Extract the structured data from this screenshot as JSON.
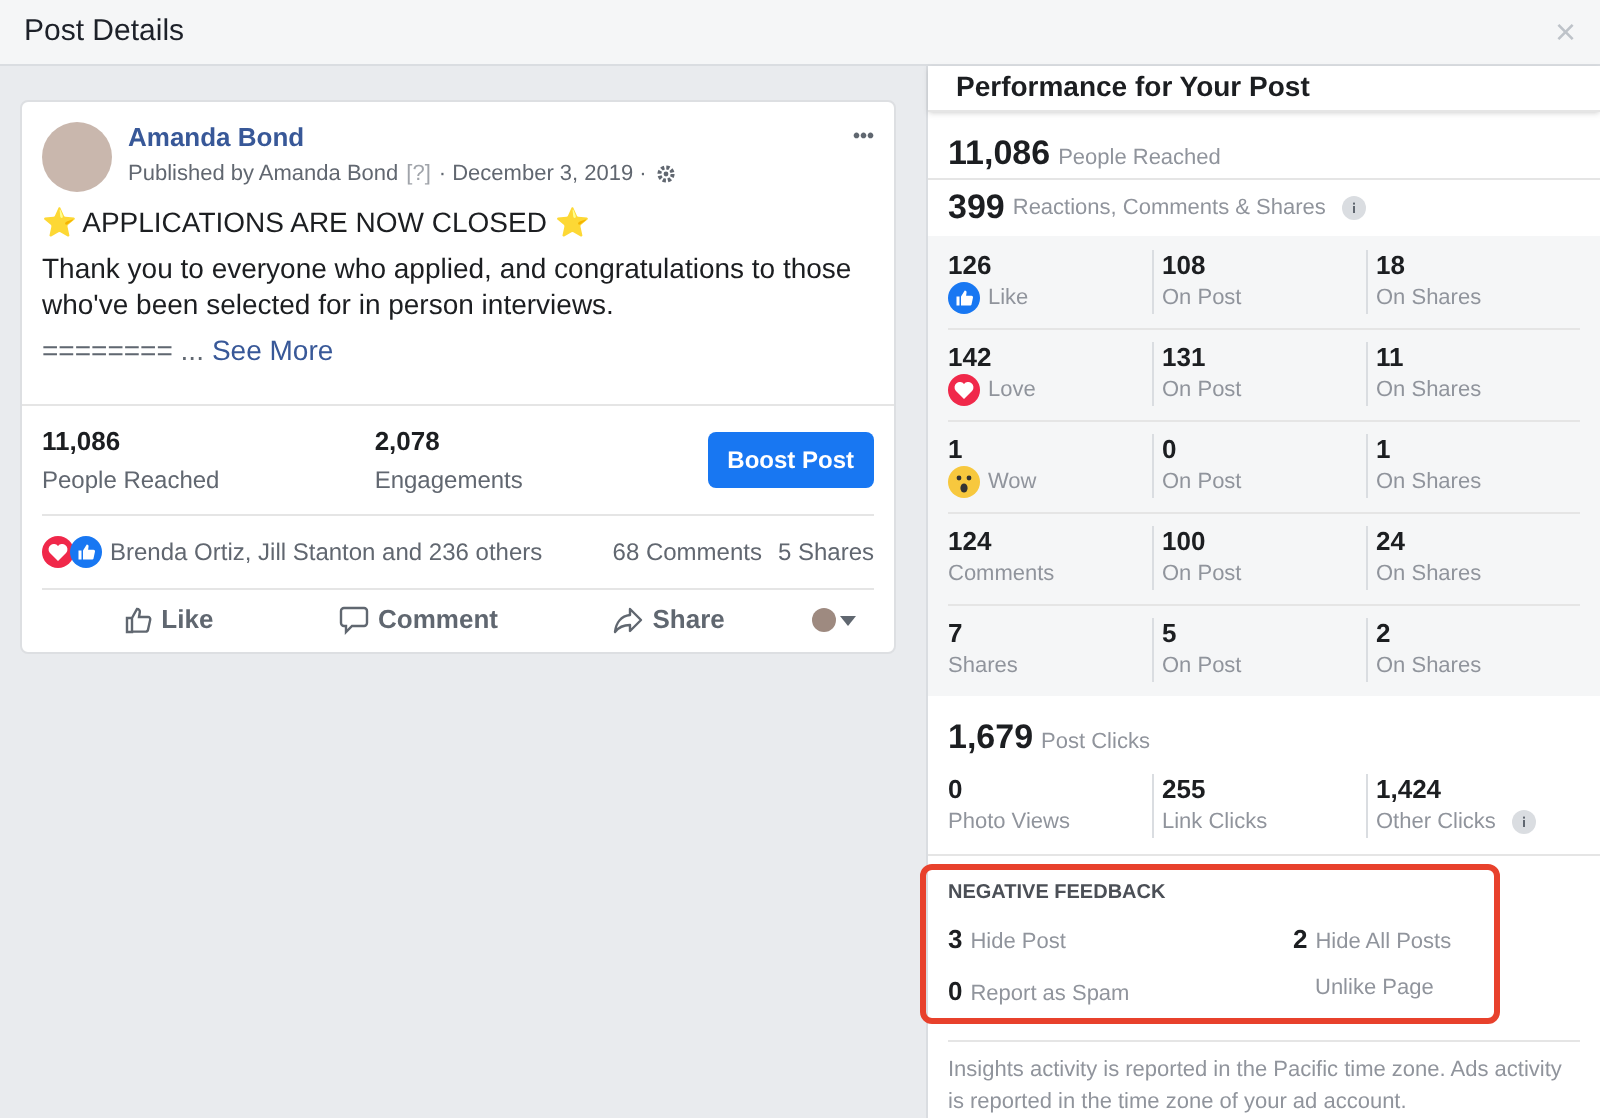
{
  "window": {
    "title": "Post Details",
    "close": "×"
  },
  "post": {
    "author": "Amanda Bond",
    "published_by": "Published by Amanda Bond",
    "help": "[?]",
    "date": "· December 3, 2019 ·",
    "menu": "•••",
    "headline": "⭐ APPLICATIONS ARE NOW CLOSED ⭐",
    "body": "Thank you to everyone who applied, and congratulations to those who've been selected for in person interviews.",
    "teaser": "======== ...",
    "see_more": "See More",
    "stats": [
      {
        "value": "11,086",
        "label": "People Reached"
      },
      {
        "value": "2,078",
        "label": "Engagements"
      }
    ],
    "boost": "Boost Post",
    "reactors": "Brenda Ortiz, Jill Stanton and 236 others",
    "comments": "68 Comments",
    "shares": "5 Shares",
    "actions": [
      {
        "kind": "like",
        "label": "Like"
      },
      {
        "kind": "comment",
        "label": "Comment"
      },
      {
        "kind": "share",
        "label": "Share"
      }
    ]
  },
  "performance": {
    "title": "Performance for Your Post",
    "reached": {
      "value": "11,086",
      "label": "People Reached"
    },
    "engagement": {
      "value": "399",
      "label": "Reactions, Comments & Shares"
    },
    "breakdown": [
      {
        "kind": "like",
        "value": "126",
        "label": "Like",
        "on_post": "108",
        "on_post_label": "On Post",
        "on_shares": "18",
        "on_shares_label": "On Shares"
      },
      {
        "kind": "love",
        "value": "142",
        "label": "Love",
        "on_post": "131",
        "on_post_label": "On Post",
        "on_shares": "11",
        "on_shares_label": "On Shares"
      },
      {
        "kind": "wow",
        "value": "1",
        "label": "Wow",
        "on_post": "0",
        "on_post_label": "On Post",
        "on_shares": "1",
        "on_shares_label": "On Shares"
      },
      {
        "kind": "plain",
        "value": "124",
        "label": "Comments",
        "on_post": "100",
        "on_post_label": "On Post",
        "on_shares": "24",
        "on_shares_label": "On Shares"
      },
      {
        "kind": "plain",
        "value": "7",
        "label": "Shares",
        "on_post": "5",
        "on_post_label": "On Post",
        "on_shares": "2",
        "on_shares_label": "On Shares"
      }
    ],
    "clicks": {
      "value": "1,679",
      "label": "Post Clicks",
      "items": [
        {
          "value": "0",
          "label": "Photo Views",
          "info": false
        },
        {
          "value": "255",
          "label": "Link Clicks",
          "info": false
        },
        {
          "value": "1,424",
          "label": "Other Clicks",
          "info": true
        }
      ]
    },
    "negative": {
      "title": "NEGATIVE FEEDBACK",
      "items": [
        {
          "value": "3",
          "label": "Hide Post"
        },
        {
          "value": "2",
          "label": "Hide All Posts"
        },
        {
          "value": "0",
          "label": "Report as Spam"
        },
        {
          "label": "Unlike Page"
        }
      ]
    },
    "footnote": "Insights activity is reported in the Pacific time zone. Ads activity is reported in the time zone of your ad account."
  }
}
